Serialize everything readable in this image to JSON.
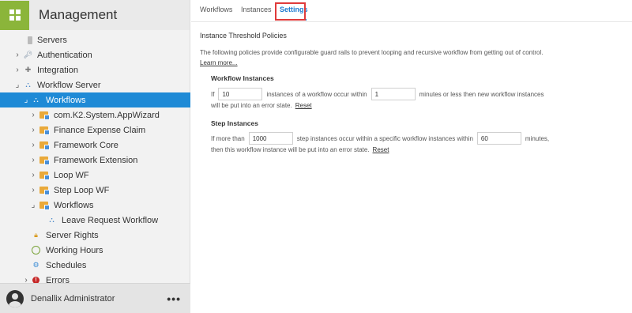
{
  "sidebar": {
    "title": "Management",
    "tree": [
      {
        "label": "Servers",
        "icon": "server-icon",
        "arrow": ""
      },
      {
        "label": "Authentication",
        "icon": "key-icon",
        "arrow": "›"
      },
      {
        "label": "Integration",
        "icon": "puzzle-icon",
        "arrow": "›"
      },
      {
        "label": "Workflow Server",
        "icon": "workflow-icon",
        "arrow": "⌟"
      },
      {
        "label": "Workflows",
        "icon": "workflow-icon",
        "arrow": "⌟",
        "selected": true
      },
      {
        "label": "com.K2.System.AppWizard",
        "icon": "folder-icon",
        "arrow": "›"
      },
      {
        "label": "Finance Expense Claim",
        "icon": "folder-icon",
        "arrow": "›"
      },
      {
        "label": "Framework Core",
        "icon": "folder-icon",
        "arrow": "›"
      },
      {
        "label": "Framework Extension",
        "icon": "folder-icon",
        "arrow": "›"
      },
      {
        "label": "Loop WF",
        "icon": "folder-icon",
        "arrow": "›"
      },
      {
        "label": "Step Loop WF",
        "icon": "folder-icon",
        "arrow": "›"
      },
      {
        "label": "Workflows",
        "icon": "folder-icon",
        "arrow": "⌟"
      },
      {
        "label": "Leave Request Workflow",
        "icon": "workflow-icon",
        "arrow": ""
      },
      {
        "label": "Server Rights",
        "icon": "lock-icon",
        "arrow": ""
      },
      {
        "label": "Working Hours",
        "icon": "clock-icon",
        "arrow": ""
      },
      {
        "label": "Schedules",
        "icon": "schedule-icon",
        "arrow": ""
      },
      {
        "label": "Errors",
        "icon": "error-icon",
        "arrow": "›"
      }
    ],
    "user": "Denallix Administrator",
    "more": "•••"
  },
  "tabs": [
    {
      "label": "Workflows"
    },
    {
      "label": "Instances"
    },
    {
      "label": "Settings",
      "active": true
    }
  ],
  "settings": {
    "heading": "Instance Threshold Policies",
    "description": "The following policies provide configurable guard rails to prevent looping and recursive workflow from getting out of control.",
    "learn_more": "Learn more...",
    "workflow_instances": {
      "title": "Workflow Instances",
      "prefix": "If",
      "count_value": "10",
      "middle": "instances of a workflow occur within",
      "minutes_value": "1",
      "suffix": "minutes or less then new workflow instances",
      "line2": "will be put into an error state.",
      "reset": "Reset"
    },
    "step_instances": {
      "title": "Step Instances",
      "prefix": "If more than",
      "count_value": "1000",
      "middle": "step instances occur within a specific workflow instances within",
      "minutes_value": "60",
      "suffix": "minutes,",
      "line2": "then this workflow instance will be put into an error state.",
      "reset": "Reset"
    }
  },
  "colors": {
    "accent": "#1e8ad6",
    "logo": "#8bb53a",
    "highlight": "#e03b3b"
  }
}
